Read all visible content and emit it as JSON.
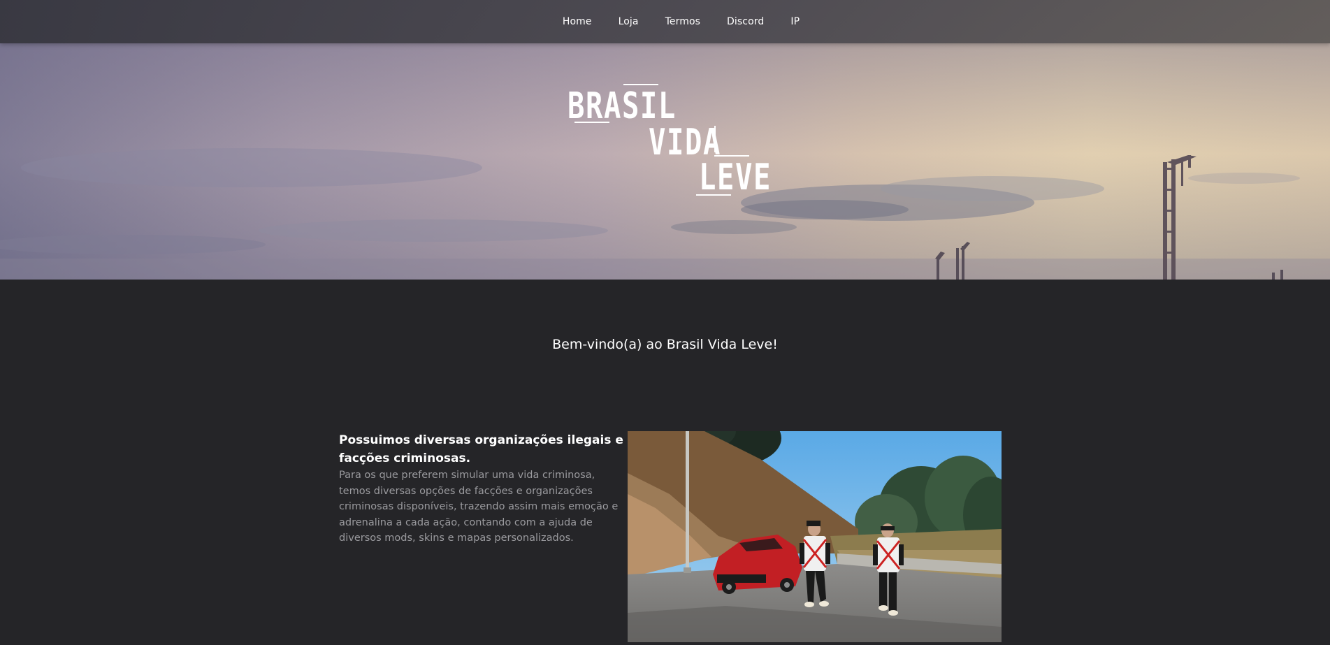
{
  "nav": {
    "items": [
      {
        "label": "Home"
      },
      {
        "label": "Loja"
      },
      {
        "label": "Termos"
      },
      {
        "label": "Discord"
      },
      {
        "label": "IP"
      }
    ]
  },
  "logo": {
    "line1": "BRASIL",
    "line2": "VIDA",
    "line3": "LEVE"
  },
  "welcome": {
    "text": "Bem-vindo(a) ao Brasil Vida Leve!"
  },
  "feature": {
    "title": "Possuimos diversas organizações ilegais e facções criminosas.",
    "description": "Para os que preferem simular uma vida criminosa, temos diversas opções de facções e organizações criminosas disponíveis, trazendo assim mais emoção e adrenalina a cada ação, contando com a ajuda de diversos mods, skins e mapas personalizados.",
    "image_icon": "game-screenshot-image"
  },
  "colors": {
    "page_background": "#252528",
    "navbar_background": "#3c3b42",
    "text_primary": "#ffffff",
    "text_secondary": "#9a9a9e"
  }
}
